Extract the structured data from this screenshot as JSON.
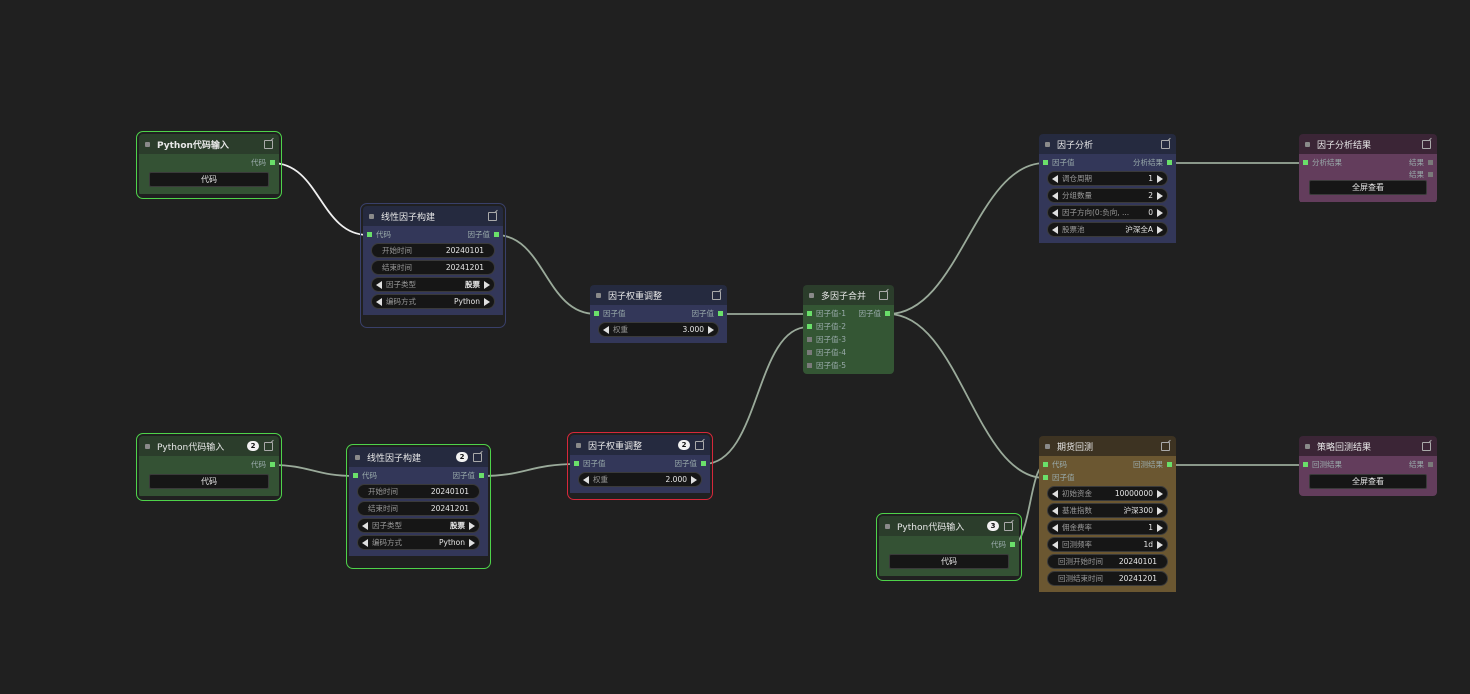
{
  "colors": {
    "canvas": "#202020",
    "port_active": "#6adf6a",
    "selected_green": "#4ed34a",
    "selected_red": "#d6283a",
    "wire": "#9aaa9a"
  },
  "nodes": {
    "py1": {
      "title": "Python代码输入",
      "output": "代码",
      "button": "代码"
    },
    "lin1": {
      "title": "线性因子构建",
      "input": "代码",
      "output": "因子值",
      "start_label": "开始时间",
      "start_value": "20240101",
      "end_label": "结束时间",
      "end_value": "20241201",
      "type_label": "因子类型",
      "type_value": "股票",
      "enc_label": "编码方式",
      "enc_value": "Python"
    },
    "wt1": {
      "title": "因子权重调整",
      "input": "因子值",
      "output": "因子值",
      "weight_label": "权重",
      "weight_value": "3.000"
    },
    "merge": {
      "title": "多因子合并",
      "output": "因子值",
      "inputs": [
        "因子值-1",
        "因子值-2",
        "因子值-3",
        "因子值-4",
        "因子值-5"
      ]
    },
    "ana": {
      "title": "因子分析",
      "input": "因子值",
      "output": "分析结果",
      "w1_label": "调仓周期",
      "w1_value": "1",
      "w2_label": "分组数量",
      "w2_value": "2",
      "w3_label": "因子方向(0:负向, ...",
      "w3_value": "0",
      "w4_label": "股票池",
      "w4_value": "沪深全A"
    },
    "anares": {
      "title": "因子分析结果",
      "input": "分析结果",
      "out1": "结果",
      "out2": "结果",
      "button": "全屏查看"
    },
    "py2": {
      "title": "Python代码输入",
      "badge": "2",
      "output": "代码",
      "button": "代码"
    },
    "lin2": {
      "title": "线性因子构建",
      "badge": "2",
      "input": "代码",
      "output": "因子值",
      "start_label": "开始时间",
      "start_value": "20240101",
      "end_label": "结束时间",
      "end_value": "20241201",
      "type_label": "因子类型",
      "type_value": "股票",
      "enc_label": "编码方式",
      "enc_value": "Python"
    },
    "wt2": {
      "title": "因子权重调整",
      "badge": "2",
      "input": "因子值",
      "output": "因子值",
      "weight_label": "权重",
      "weight_value": "2.000"
    },
    "bt": {
      "title": "期货回测",
      "input1": "代码",
      "input2": "因子值",
      "output": "回测结果",
      "w1_label": "初始资金",
      "w1_value": "10000000",
      "w2_label": "基准指数",
      "w2_value": "沪深300",
      "w3_label": "佣金费率",
      "w3_value": "1",
      "w4_label": "回测频率",
      "w4_value": "1d",
      "w5_label": "回测开始时间",
      "w5_value": "20240101",
      "w6_label": "回测结束时间",
      "w6_value": "20241201"
    },
    "btres": {
      "title": "策略回测结果",
      "input": "回测结果",
      "output": "结果",
      "button": "全屏查看"
    },
    "py3": {
      "title": "Python代码输入",
      "badge": "3",
      "output": "代码",
      "button": "代码"
    }
  }
}
